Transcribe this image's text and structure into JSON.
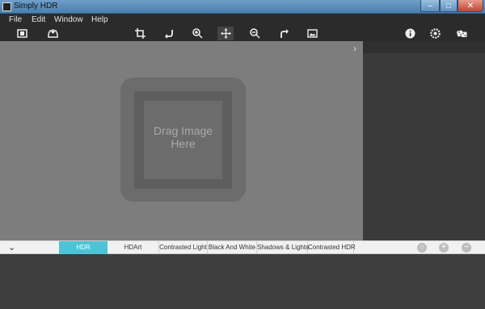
{
  "window": {
    "title": "Simply HDR",
    "minimize": "–",
    "maximize": "□",
    "close": "✕"
  },
  "menu": [
    "File",
    "Edit",
    "Window",
    "Help"
  ],
  "toolbar": {
    "left": [
      "fit-screen-icon",
      "save-tray-icon"
    ],
    "center": [
      "crop-icon",
      "rotate-left-icon",
      "zoom-in-icon",
      "move-icon",
      "zoom-out-icon",
      "rotate-right-icon",
      "compare-icon"
    ],
    "right": [
      "info-icon",
      "settings-icon",
      "random-dice-icon"
    ],
    "active": "move-icon"
  },
  "canvas": {
    "drop_text_line1": "Drag Image",
    "drop_text_line2": "Here",
    "collapse_arrow": "›"
  },
  "presets": {
    "toggle": "⌄",
    "items": [
      "HDR",
      "HDArt",
      "Contrasted Light",
      "Black And White",
      "Shadows & Lights",
      "Contrasted HDR"
    ],
    "selected": "HDR",
    "actions": {
      "reset": "○",
      "add": "+",
      "remove": "−"
    }
  },
  "colors": {
    "accent": "#4dc4d6",
    "canvas": "#7d7d7d",
    "chrome": "#2b2b2b"
  }
}
